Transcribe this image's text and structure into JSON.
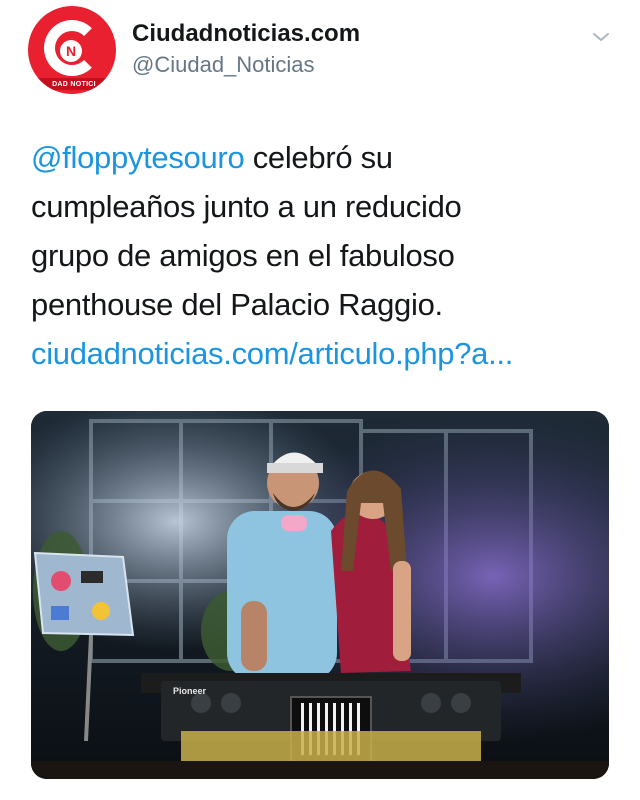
{
  "account": {
    "display_name": "Ciudadnoticias.com",
    "handle": "@Ciudad_Noticias",
    "avatar_letter": "N",
    "avatar_ribbon": "DAD NOTICI"
  },
  "tweet": {
    "mention": "@floppytesouro",
    "text_line1_rest": " celebró su",
    "text_line2": "cumpleaños junto a un reducido",
    "text_line3": "grupo de amigos en el fabuloso",
    "text_line4": "penthouse del Palacio Raggio.",
    "link": "ciudadnoticias.com/articulo.php?a..."
  },
  "photo": {
    "equipment_brand": "Pioneer"
  },
  "colors": {
    "link": "#1b95e0",
    "text": "#14171a",
    "muted": "#657786",
    "brand_red": "#e8202f"
  },
  "icons": [
    "chevron-down-icon"
  ]
}
